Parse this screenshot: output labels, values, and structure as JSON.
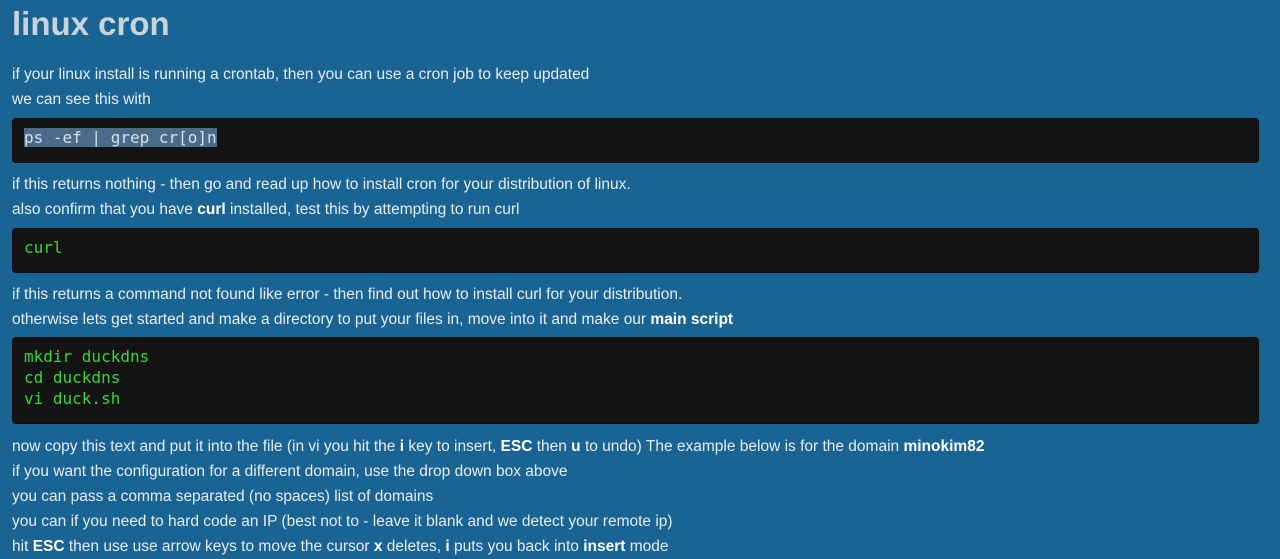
{
  "title": "linux cron",
  "intro": {
    "line1": "if your linux install is running a crontab, then you can use a cron job to keep updated",
    "line2": "we can see this with"
  },
  "code_ps": "ps -ef | grep cr[o]n",
  "section2": {
    "line1": "if this returns nothing - then go and read up how to install cron for your distribution of linux.",
    "line2_before": "also confirm that you have ",
    "line2_bold": "curl",
    "line2_after": " installed, test this by attempting to run curl"
  },
  "code_curl": "curl",
  "section3": {
    "line1": "if this returns a command not found like error - then find out how to install curl for your distribution.",
    "line2_before": "otherwise lets get started and make a directory to put your files in, move into it and make our ",
    "line2_bold": "main script"
  },
  "code_mkdir": [
    "mkdir duckdns",
    "cd duckdns",
    "vi duck.sh"
  ],
  "section4": {
    "line1_a": "now copy this text and put it into the file (in vi you hit the ",
    "line1_b": "i",
    "line1_c": " key to insert, ",
    "line1_d": "ESC",
    "line1_e": " then ",
    "line1_f": "u",
    "line1_g": " to undo) The example below is for the domain ",
    "line1_h": "minokim82",
    "line2": "if you want the configuration for a different domain, use the drop down box above",
    "line3": "you can pass a comma separated (no spaces) list of domains",
    "line4": "you can if you need to hard code an IP (best not to - leave it blank and we detect your remote ip)",
    "line5_a": "hit ",
    "line5_b": "ESC",
    "line5_c": " then use use arrow keys to move the cursor ",
    "line5_d": "x",
    "line5_e": " deletes, ",
    "line5_f": "i",
    "line5_g": " puts you back into ",
    "line5_h": "insert",
    "line5_i": " mode"
  },
  "colors": {
    "background": "#1a6494",
    "code_background": "#141414",
    "code_text": "#39d636",
    "selection": "#4a6b8a"
  }
}
